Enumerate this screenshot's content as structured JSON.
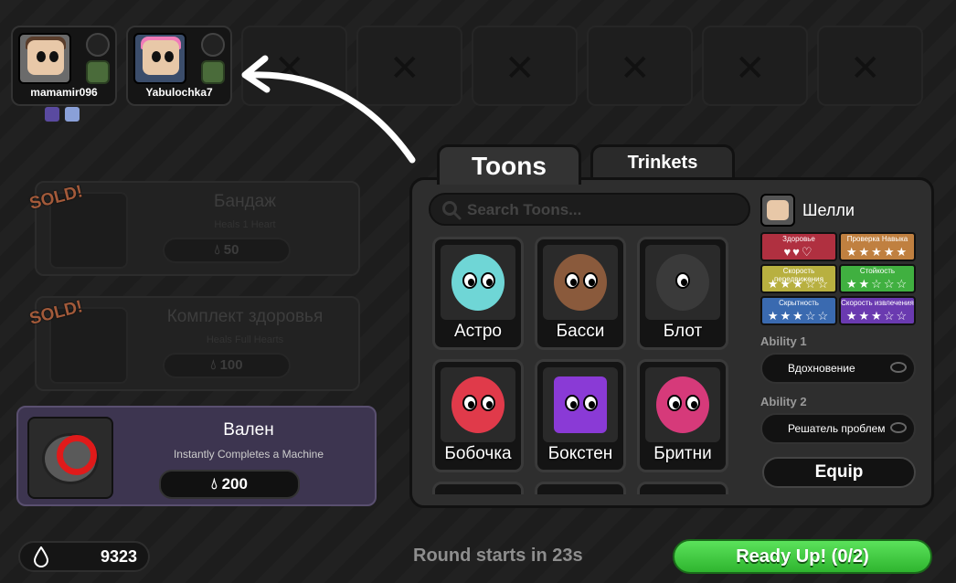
{
  "players": [
    {
      "name": "mamamir096"
    },
    {
      "name": "Yabulochka7"
    }
  ],
  "shop": [
    {
      "title": "Бандаж",
      "subtitle": "Heals 1 Heart",
      "price": "50",
      "sold_label": "SOLD!"
    },
    {
      "title": "Комплект здоровья",
      "subtitle": "Heals Full Hearts",
      "price": "100",
      "sold_label": "SOLD!"
    },
    {
      "title": "Вален",
      "subtitle": "Instantly Completes a Machine",
      "price": "200"
    }
  ],
  "currency": {
    "amount": "9323"
  },
  "round_text": "Round starts in 23s",
  "ready_label": "Ready Up! (0/2)",
  "tabs": {
    "toons": "Toons",
    "trinkets": "Trinkets"
  },
  "search": {
    "placeholder": "Search Toons..."
  },
  "toons": [
    {
      "name": "Астро",
      "color": "#6fd6d6"
    },
    {
      "name": "Басси",
      "color": "#8a5a3c"
    },
    {
      "name": "Блот",
      "color": "#3a3a3a"
    },
    {
      "name": "Бобочка",
      "color": "#e03a4a"
    },
    {
      "name": "Бокстен",
      "color": "#8a3ad6"
    },
    {
      "name": "Бритни",
      "color": "#d63a7a"
    }
  ],
  "selected": {
    "name": "Шелли",
    "stats": [
      {
        "label": "Здоровье",
        "value": "♥♥♡",
        "color": "#b03040"
      },
      {
        "label": "Проверка Навыка",
        "value": "★★★★★",
        "color": "#c08040"
      },
      {
        "label": "Скорость передвижения",
        "value": "★★★☆☆",
        "color": "#b8b040"
      },
      {
        "label": "Стойкость",
        "value": "★★☆☆☆",
        "color": "#40b040"
      },
      {
        "label": "Скрытность",
        "value": "★★★☆☆",
        "color": "#3a6ab0"
      },
      {
        "label": "Скорость извлечения",
        "value": "★★★☆☆",
        "color": "#6a3ab0"
      }
    ],
    "ability1_label": "Ability 1",
    "ability1": "Вдохновение",
    "ability2_label": "Ability 2",
    "ability2": "Решатель проблем",
    "equip_label": "Equip"
  }
}
